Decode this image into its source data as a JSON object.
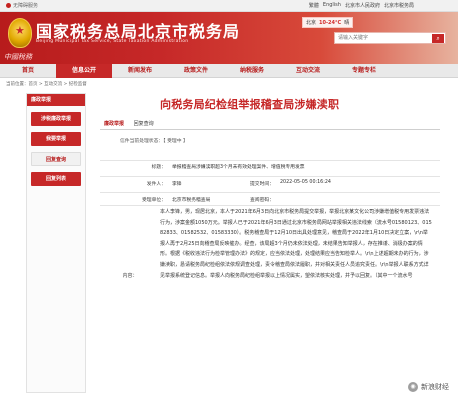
{
  "topbar": {
    "brand": "无障碍服务",
    "links": [
      "繁體",
      "English",
      "北京市人民政府",
      "北京市税务局"
    ]
  },
  "header": {
    "title_cn": "国家税务总局北京市税务局",
    "title_en": "Beijing Municipal Tax Service, State Taxation Administration",
    "brand_mark": "中國稅務",
    "weather": {
      "city": "北京",
      "temp": "10-24°C",
      "condition": "晴"
    },
    "search_placeholder": "请输入关键字"
  },
  "nav": {
    "items": [
      "首页",
      "信息公开",
      "新闻发布",
      "政策文件",
      "纳税服务",
      "互动交流",
      "专题专栏"
    ],
    "active_index": 1
  },
  "breadcrumb": "当前位置：首页 > 互动交流 > 纪检监督",
  "sidebar": {
    "head": "廉政举报",
    "items": [
      {
        "label": "涉税廉政举报",
        "light": false
      },
      {
        "label": "我要举报",
        "light": false
      },
      {
        "label": "回复查询",
        "light": true
      },
      {
        "label": "回复列表",
        "light": false
      }
    ]
  },
  "overlay_title": "向税务局纪检组举报稽查局涉嫌渎职",
  "tabs": [
    "廉政举报",
    "回复查询"
  ],
  "status_line": {
    "label": "信息当前处理状态：",
    "value": "信件当前处理状态：【 受理中 】"
  },
  "form": {
    "rows": [
      {
        "label": "标题：",
        "value": "举报稽查局涉嫌渎职超3个月未有效处理案件、增值税专用发票"
      },
      {
        "label": "发件人：",
        "value": "李锋",
        "extra_label": "提交时间：",
        "extra_value": "2022-05-05 00:16:24"
      },
      {
        "label": "受理单位：",
        "value": "北京市税务稽查局",
        "extra_label": "查阅密码：",
        "extra_value": ""
      }
    ]
  },
  "content_label": "内容：",
  "content": "本人李锋，男，现居北京，本人于2021年6月3日向北京市税务局提交举报，举报北京某文化公司涉嫌增值税专用发票违法行为，涉案金额1050万元。举报人已于2021年6月3日通过北京市税务局网站举报相关违法线索（流水号01580123、01582833、01582532、01583330）。税务稽查局于12月10日出具处理意见，稽查局于2022年1月10日决定立案，\\r\\n举报人再于2月25日向稽查局反映催办。经查，该局超3个月仍未依法处理，未结果告知举报人，存在推诿、消极办案的情形。根据《税收违法行为检举管理办法》的规定，应当依法处理，处理结果应当告知检举人。\\r\\n上述超期未办的行为，涉嫌渎职，恳请税务局纪检组依法依规调查处理，责令稽查局依法履职，并对相关责任人员追究责任。\\r\\n举报人联系方式详见举报系统登记信息。举报人向税务局纪检组举报以上情况属实，望依法核实处理，并予以回复。（其中一个流水号",
  "watermark": "新浪财经"
}
